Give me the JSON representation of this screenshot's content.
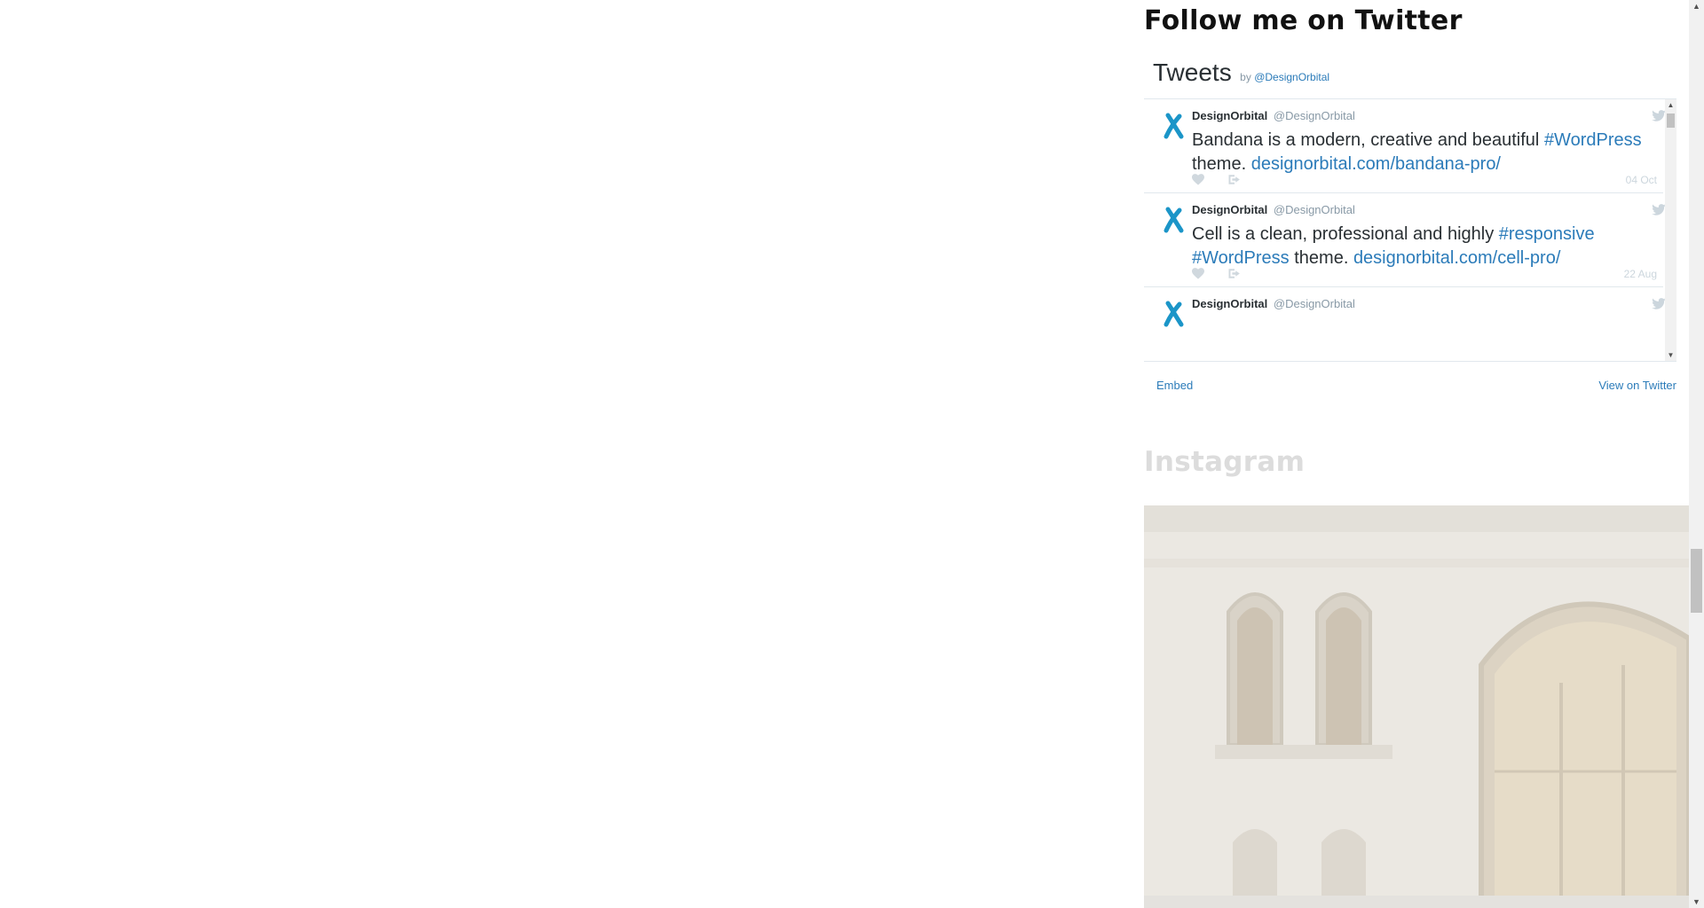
{
  "twitter_widget": {
    "title": "Follow me on Twitter",
    "header_tweets": "Tweets",
    "header_by": "by",
    "header_handle": "@DesignOrbital",
    "tweets": [
      {
        "name": "DesignOrbital",
        "handle": "@DesignOrbital",
        "text_parts": [
          "Bandana is a modern, creative and beautiful ",
          "#WordPress",
          " theme.  ",
          "designorbital.com/bandana-pro/"
        ],
        "date": "04 Oct"
      },
      {
        "name": "DesignOrbital",
        "handle": "@DesignOrbital",
        "text_parts": [
          "Cell is a clean, professional and highly ",
          "#responsive",
          " ",
          "#WordPress",
          " theme. ",
          "designorbital.com/cell-pro/"
        ],
        "date": "22 Aug"
      },
      {
        "name": "DesignOrbital",
        "handle": "@DesignOrbital"
      }
    ],
    "footer_embed": "Embed",
    "footer_view": "View on Twitter",
    "colors": {
      "link": "#2b7bb9",
      "text": "#292f33",
      "muted": "#8899a6",
      "avatar": "#1b95c8"
    }
  },
  "instagram_widget": {
    "title": "Instagram"
  },
  "icons": {
    "avatar": "designorbital-logo-icon",
    "bird": "twitter-bird-icon",
    "heart": "heart-icon",
    "share": "share-icon"
  }
}
